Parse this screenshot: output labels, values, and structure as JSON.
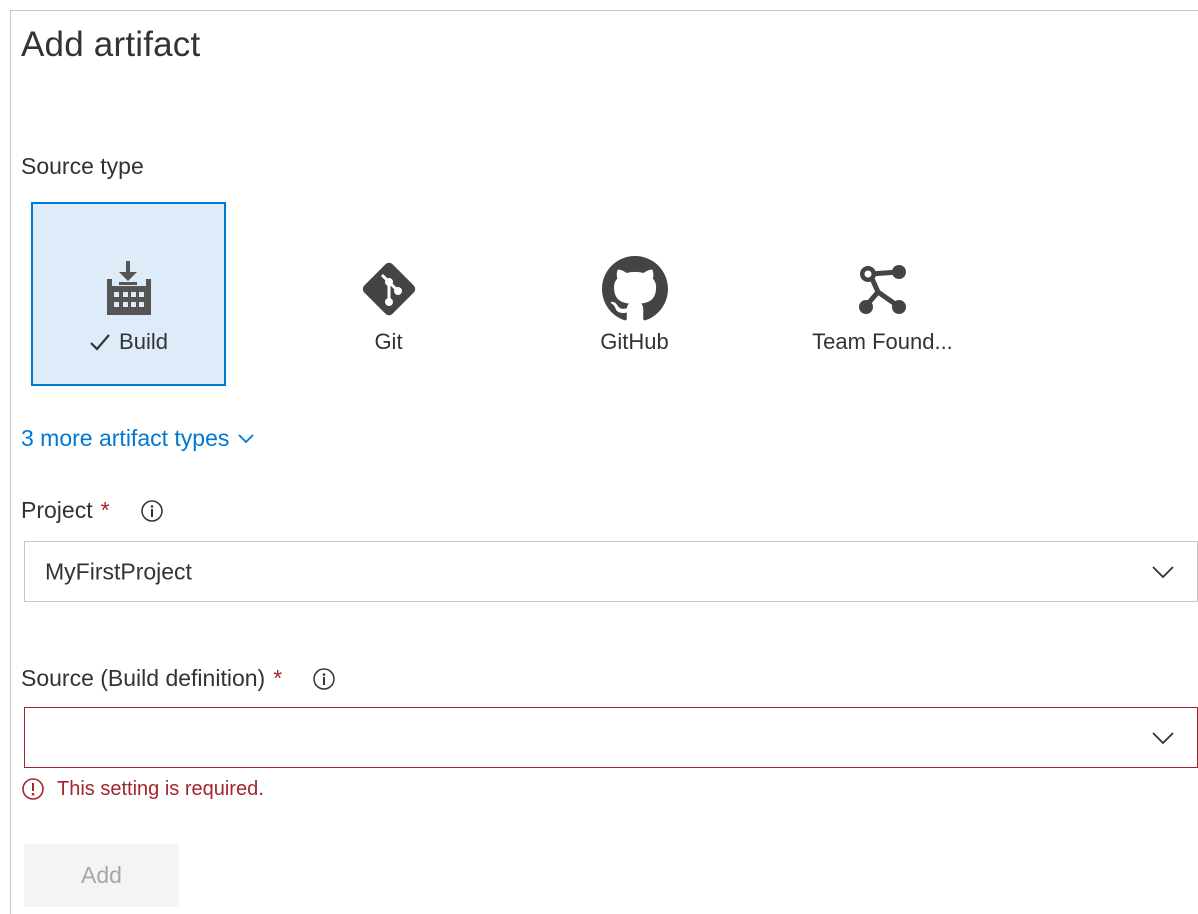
{
  "dialog": {
    "title": "Add artifact"
  },
  "source_type": {
    "label": "Source type",
    "tiles": [
      {
        "label": "Build",
        "icon": "build-icon",
        "selected": true
      },
      {
        "label": "Git",
        "icon": "git-icon",
        "selected": false
      },
      {
        "label": "GitHub",
        "icon": "github-icon",
        "selected": false
      },
      {
        "label": "Team Found...",
        "icon": "tfvc-icon",
        "selected": false
      }
    ],
    "more_link": "3 more artifact types"
  },
  "project": {
    "label": "Project",
    "required_mark": "*",
    "value": "MyFirstProject"
  },
  "source": {
    "label": "Source (Build definition)",
    "required_mark": "*",
    "value": "",
    "error": "This setting is required."
  },
  "actions": {
    "add_label": "Add"
  },
  "colors": {
    "accent": "#0078d4",
    "selected_bg": "#deecf9",
    "error": "#a4262c",
    "icon_gray": "#444444",
    "disabled_text": "#a6a6a6"
  }
}
